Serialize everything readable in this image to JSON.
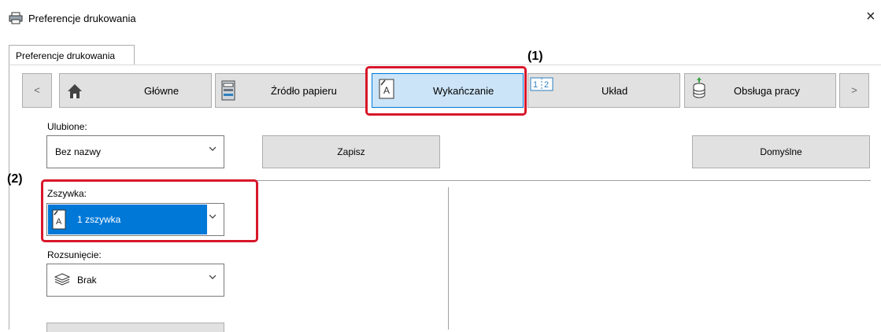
{
  "window": {
    "title": "Preferencje drukowania",
    "close_glyph": "×"
  },
  "tabs": [
    {
      "label": "Preferencje drukowania",
      "active": true
    }
  ],
  "nav": {
    "prev": "<",
    "next": ">",
    "items": [
      {
        "label": "Główne",
        "icon": "home-icon"
      },
      {
        "label": "Źródło papieru",
        "icon": "paper-source-icon"
      },
      {
        "label": "Wykańczanie",
        "icon": "finishing-icon",
        "selected": true
      },
      {
        "label": "Układ",
        "icon": "layout-icon"
      },
      {
        "label": "Obsługa pracy",
        "icon": "job-handling-icon"
      }
    ]
  },
  "favorites": {
    "label": "Ulubione:",
    "value": "Bez nazwy",
    "save": "Zapisz",
    "defaults": "Domyślne"
  },
  "staple": {
    "label": "Zszywka:",
    "value": "1 zszywka"
  },
  "offset": {
    "label": "Rozsunięcie:",
    "value": "Brak"
  },
  "annotations": {
    "one": "(1)",
    "two": "(2)"
  },
  "colors": {
    "selected_bg": "#cce4f7",
    "selected_border": "#0078d7",
    "dropdown_selected": "#0078d7",
    "highlight_box": "#d8172a"
  }
}
